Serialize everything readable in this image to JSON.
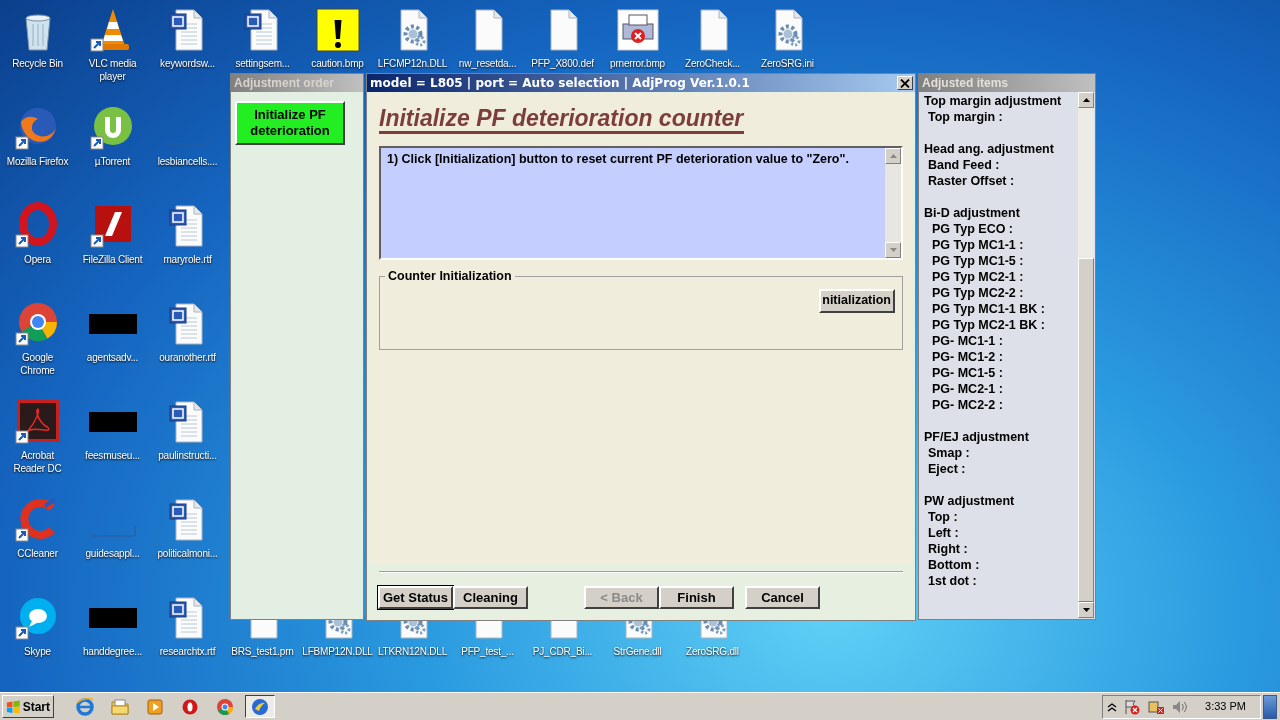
{
  "desktop": {
    "rows": [
      [
        {
          "label": "Recycle Bin",
          "kind": "recycle",
          "shortcut": false
        },
        {
          "label": "VLC media\nplayer",
          "kind": "vlc",
          "shortcut": true
        },
        {
          "label": "keywordsw...",
          "kind": "word",
          "shortcut": false
        },
        {
          "label": "settingsem...",
          "kind": "word",
          "shortcut": false
        },
        {
          "label": "caution.bmp",
          "kind": "caution",
          "shortcut": false
        },
        {
          "label": "LFCMP12n.DLL",
          "kind": "gear",
          "shortcut": false
        },
        {
          "label": "nw_resetda...",
          "kind": "blank",
          "shortcut": false
        },
        {
          "label": "PFP_X800.def",
          "kind": "blank",
          "shortcut": false
        },
        {
          "label": "prnerror.bmp",
          "kind": "printer",
          "shortcut": false
        },
        {
          "label": "ZeroCheck...",
          "kind": "blank",
          "shortcut": false
        },
        {
          "label": "ZeroSRG.ini",
          "kind": "gear",
          "shortcut": false
        }
      ],
      [
        {
          "label": "Mozilla Firefox",
          "kind": "firefox",
          "shortcut": true
        },
        {
          "label": "µTorrent",
          "kind": "utorrent",
          "shortcut": true
        },
        {
          "label": "lesbiancells....",
          "kind": "outline",
          "shortcut": false
        }
      ],
      [
        {
          "label": "Opera",
          "kind": "opera",
          "shortcut": true
        },
        {
          "label": "FileZilla Client",
          "kind": "filezilla",
          "shortcut": true
        },
        {
          "label": "maryrole.rtf",
          "kind": "word",
          "shortcut": false
        }
      ],
      [
        {
          "label": "Google\nChrome",
          "kind": "chrome",
          "shortcut": true
        },
        {
          "label": "agentsadv...",
          "kind": "black",
          "shortcut": false
        },
        {
          "label": "ouranother.rtf",
          "kind": "word",
          "shortcut": false
        }
      ],
      [
        {
          "label": "Acrobat\nReader DC",
          "kind": "acrobat",
          "shortcut": true
        },
        {
          "label": "feesmuseu...",
          "kind": "black",
          "shortcut": false
        },
        {
          "label": "paulinstructi...",
          "kind": "word",
          "shortcut": false
        }
      ],
      [
        {
          "label": "CCleaner",
          "kind": "ccleaner",
          "shortcut": true
        },
        {
          "label": "guidesappl...",
          "kind": "outline",
          "shortcut": false
        },
        {
          "label": "politicalmoni...",
          "kind": "word",
          "shortcut": false
        }
      ],
      [
        {
          "label": "Skype",
          "kind": "skype",
          "shortcut": true
        },
        {
          "label": "handdegree...",
          "kind": "black",
          "shortcut": false
        },
        {
          "label": "researchtx.rtf",
          "kind": "word",
          "shortcut": false
        },
        {
          "label": "BRS_test1.prn",
          "kind": "blank",
          "shortcut": false
        },
        {
          "label": "LFBMP12N.DLL",
          "kind": "gear",
          "shortcut": false
        },
        {
          "label": "LTKRN12N.DLL",
          "kind": "gear",
          "shortcut": false
        },
        {
          "label": "PFP_test_...",
          "kind": "blank",
          "shortcut": false
        },
        {
          "label": "PJ_CDR_Bi...",
          "kind": "blank",
          "shortcut": false
        },
        {
          "label": "StrGene.dll",
          "kind": "gear",
          "shortcut": false
        },
        {
          "label": "ZeroSRG.dll",
          "kind": "gear",
          "shortcut": false
        }
      ]
    ]
  },
  "adjustment_order": {
    "title": "Adjustment order",
    "steps": [
      {
        "label": "Initialize PF\ndeterioration",
        "selected": true
      }
    ]
  },
  "dialog": {
    "title": "model = L805 | port = Auto selection | AdjProg Ver.1.0.1",
    "heading": "Initialize PF deterioration counter",
    "instructions": "1) Click [Initialization] button to reset current PF deterioration value to \"Zero\".",
    "group": {
      "title": "Counter Initialization",
      "button": "nitialization"
    },
    "buttons": [
      {
        "label": "Get Status",
        "focused": true,
        "disabled": false
      },
      {
        "label": "Cleaning",
        "focused": false,
        "disabled": false
      },
      {
        "label": "< Back",
        "focused": false,
        "disabled": true
      },
      {
        "label": "Finish",
        "focused": false,
        "disabled": false
      },
      {
        "label": "Cancel",
        "focused": false,
        "disabled": false
      }
    ]
  },
  "adjusted_items": {
    "title": "Adjusted items",
    "sections": [
      {
        "heading": "Top margin adjustment",
        "items": [
          "Top margin :"
        ]
      },
      {
        "heading": "Head ang. adjustment",
        "items": [
          "Band Feed :",
          "Raster Offset :"
        ]
      },
      {
        "heading": "Bi-D adjustment",
        "items": [
          "PG Typ ECO :",
          "PG Typ MC1-1 :",
          "PG Typ MC1-5 :",
          "PG Typ MC2-1 :",
          "PG Typ MC2-2 :",
          "PG Typ MC1-1 BK :",
          "PG Typ MC2-1 BK :",
          "PG- MC1-1 :",
          "PG- MC1-2 :",
          "PG- MC1-5 :",
          "PG- MC2-1 :",
          "PG- MC2-2 :"
        ]
      },
      {
        "heading": "PF/EJ adjustment",
        "items": [
          "Smap :",
          "Eject :"
        ]
      },
      {
        "heading": "PW adjustment",
        "items": [
          "Top :",
          "Left :",
          "Right :",
          "Bottom :",
          "1st dot :"
        ]
      }
    ]
  },
  "taskbar": {
    "start": "Start",
    "apps": [
      {
        "kind": "ie",
        "active": false
      },
      {
        "kind": "folder",
        "active": false
      },
      {
        "kind": "media",
        "active": false
      },
      {
        "kind": "ring",
        "active": false
      },
      {
        "kind": "chrome",
        "active": false
      },
      {
        "kind": "app",
        "active": true
      }
    ],
    "clock": "3:33 PM"
  }
}
